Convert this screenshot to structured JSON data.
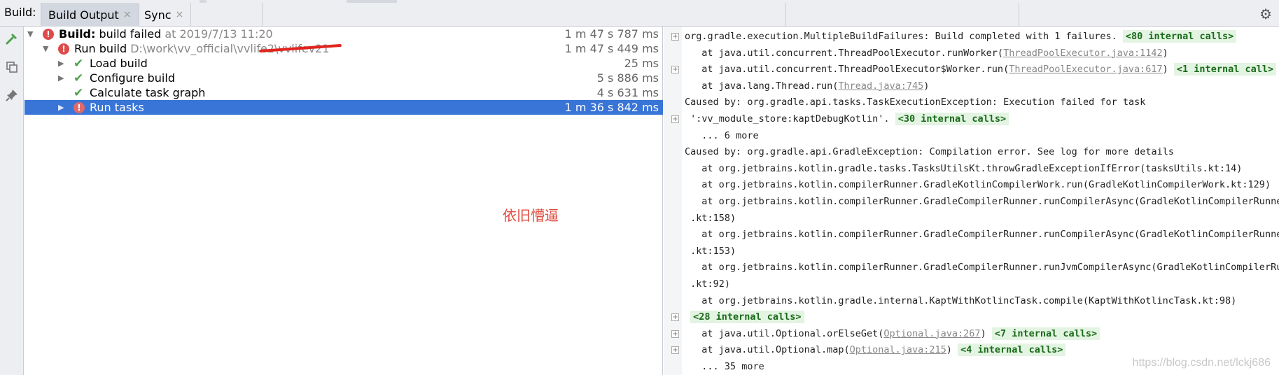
{
  "tabbar": {
    "caption": "Build:",
    "tabs": [
      {
        "label": "Build Output",
        "close": "×"
      },
      {
        "label": "Sync",
        "close": "×"
      }
    ]
  },
  "toolbar": {
    "icons": [
      "hammer-icon",
      "copy-icon",
      "pin-icon",
      "gear-icon"
    ]
  },
  "tree": {
    "rows": [
      {
        "prefix": "Build:",
        "label": " build failed",
        "meta": " at 2019/7/13 11:20",
        "time": "1 m 47 s 787 ms",
        "status": "error"
      },
      {
        "prefix": "",
        "label": "Run build",
        "meta": " D:\\work\\vv_official\\vvlife2\\",
        "meta_redacted": "vvlifev21",
        "time": "1 m 47 s 449 ms",
        "status": "error"
      },
      {
        "prefix": "",
        "label": "Load build",
        "meta": "",
        "time": "25 ms",
        "status": "ok"
      },
      {
        "prefix": "",
        "label": "Configure build",
        "meta": "",
        "time": "5 s 886 ms",
        "status": "ok"
      },
      {
        "prefix": "",
        "label": "Calculate task graph",
        "meta": "",
        "time": "4 s 631 ms",
        "status": "ok"
      },
      {
        "prefix": "",
        "label": "Run tasks",
        "meta": "",
        "time": "1 m 36 s 842 ms",
        "status": "error"
      }
    ],
    "selected_index": 5
  },
  "annotation": "依旧懵逼",
  "console": {
    "lines": [
      {
        "fold": true,
        "indent": 0,
        "text": "org.gradle.execution.MultipleBuildFailures: Build completed with 1 failures. ",
        "link": "",
        "after": "",
        "calls": "<80 internal calls>"
      },
      {
        "fold": false,
        "indent": 3,
        "text": "at java.util.concurrent.ThreadPoolExecutor.runWorker(",
        "link": "ThreadPoolExecutor.java:1142",
        "after": ")",
        "calls": ""
      },
      {
        "fold": true,
        "indent": 3,
        "text": "at java.util.concurrent.ThreadPoolExecutor$Worker.run(",
        "link": "ThreadPoolExecutor.java:617",
        "after": ") ",
        "calls": "<1 internal call>"
      },
      {
        "fold": false,
        "indent": 3,
        "text": "at java.lang.Thread.run(",
        "link": "Thread.java:745",
        "after": ")",
        "calls": ""
      },
      {
        "fold": false,
        "indent": 0,
        "text": "Caused by: org.gradle.api.tasks.TaskExecutionException: Execution failed for task",
        "link": "",
        "after": "",
        "calls": ""
      },
      {
        "fold": true,
        "indent": 1,
        "text": "':vv_module_store:kaptDebugKotlin'. ",
        "link": "",
        "after": "",
        "calls": "<30 internal calls>"
      },
      {
        "fold": false,
        "indent": 3,
        "text": "... 6 more",
        "link": "",
        "after": "",
        "calls": ""
      },
      {
        "fold": false,
        "indent": 0,
        "text": "Caused by: org.gradle.api.GradleException: Compilation error. See log for more details",
        "link": "",
        "after": "",
        "calls": ""
      },
      {
        "fold": false,
        "indent": 3,
        "text": "at org.jetbrains.kotlin.gradle.tasks.TasksUtilsKt.throwGradleExceptionIfError(tasksUtils.kt:14)",
        "link": "",
        "after": "",
        "calls": ""
      },
      {
        "fold": false,
        "indent": 3,
        "text": "at org.jetbrains.kotlin.compilerRunner.GradleKotlinCompilerWork.run(GradleKotlinCompilerWork.kt:129)",
        "link": "",
        "after": "",
        "calls": ""
      },
      {
        "fold": false,
        "indent": 3,
        "text": "at org.jetbrains.kotlin.compilerRunner.GradleCompilerRunner.runCompilerAsync(GradleKotlinCompilerRunner",
        "link": "",
        "after": "",
        "calls": ""
      },
      {
        "fold": false,
        "indent": 1,
        "text": ".kt:158)",
        "link": "",
        "after": "",
        "calls": ""
      },
      {
        "fold": false,
        "indent": 3,
        "text": "at org.jetbrains.kotlin.compilerRunner.GradleCompilerRunner.runCompilerAsync(GradleKotlinCompilerRunner",
        "link": "",
        "after": "",
        "calls": ""
      },
      {
        "fold": false,
        "indent": 1,
        "text": ".kt:153)",
        "link": "",
        "after": "",
        "calls": ""
      },
      {
        "fold": false,
        "indent": 3,
        "text": "at org.jetbrains.kotlin.compilerRunner.GradleCompilerRunner.runJvmCompilerAsync(GradleKotlinCompilerRun",
        "link": "",
        "after": "",
        "calls": ""
      },
      {
        "fold": false,
        "indent": 1,
        "text": ".kt:92)",
        "link": "",
        "after": "",
        "calls": ""
      },
      {
        "fold": false,
        "indent": 3,
        "text": "at org.jetbrains.kotlin.gradle.internal.KaptWithKotlincTask.compile(KaptWithKotlincTask.kt:98)",
        "link": "",
        "after": "",
        "calls": ""
      },
      {
        "fold": true,
        "indent": 1,
        "text": "",
        "link": "",
        "after": "",
        "calls": "<28 internal calls>"
      },
      {
        "fold": true,
        "indent": 3,
        "text": "at java.util.Optional.orElseGet(",
        "link": "Optional.java:267",
        "after": ") ",
        "calls": "<7 internal calls>"
      },
      {
        "fold": true,
        "indent": 3,
        "text": "at java.util.Optional.map(",
        "link": "Optional.java:215",
        "after": ") ",
        "calls": "<4 internal calls>"
      },
      {
        "fold": false,
        "indent": 3,
        "text": "... 35 more",
        "link": "",
        "after": "",
        "calls": ""
      }
    ]
  },
  "watermark": "https://blog.csdn.net/lckj686",
  "colors": {
    "selection": "#3875d7",
    "error": "#dd4b4b",
    "success": "#4ca34b",
    "annotation": "#e04a3c",
    "internal_calls_bg": "#e3f4e2"
  }
}
